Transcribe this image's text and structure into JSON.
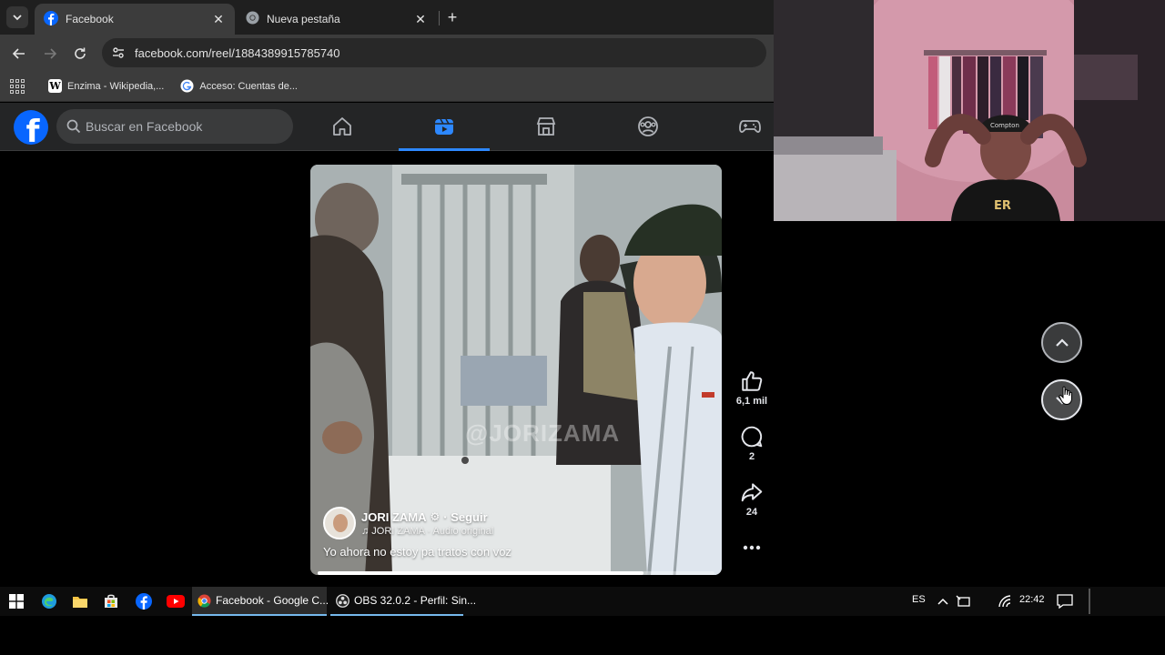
{
  "browser": {
    "tabs": [
      {
        "title": "Facebook",
        "active": true,
        "icon": "facebook-favicon-icon"
      },
      {
        "title": "Nueva pestaña",
        "active": false,
        "icon": "chrome-icon"
      }
    ],
    "url": "facebook.com/reel/1884389915785740",
    "bookmarks": [
      {
        "label": "Enzima - Wikipedia,...",
        "icon": "wikipedia-icon"
      },
      {
        "label": "Acceso: Cuentas de...",
        "icon": "google-icon"
      }
    ]
  },
  "facebook": {
    "search_placeholder": "Buscar en Facebook",
    "nav": [
      "home-icon",
      "reels-icon",
      "marketplace-icon",
      "groups-icon",
      "gaming-icon"
    ],
    "active_nav": "reels-icon"
  },
  "reel": {
    "author": "JORI ZAMA",
    "follow_label": "· Seguir",
    "audio": "♫ JORI ZAMA · Audio original",
    "caption": "Yo ahora no estoy pa tratos con voz",
    "watermark": "@JORIZAMA",
    "progress": 0.82,
    "actions": {
      "likes": "6,1 mil",
      "comments": "2",
      "shares": "24"
    }
  },
  "taskbar": {
    "apps": [
      {
        "label": "Facebook - Google C...",
        "icon": "chrome-icon",
        "active": true
      },
      {
        "label": "OBS 32.0.2 - Perfil: Sin...",
        "icon": "obs-icon",
        "active": false
      }
    ],
    "language": "ES",
    "time": "22:42"
  },
  "colors": {
    "fb_blue": "#0866ff",
    "chrome_dark": "#3c3c3c",
    "fb_header": "#242526"
  }
}
